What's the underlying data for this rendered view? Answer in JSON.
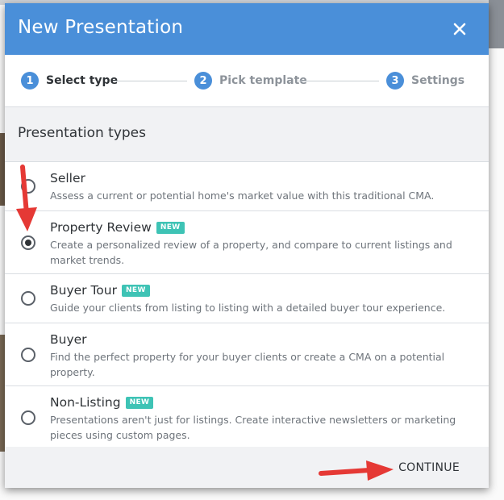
{
  "dialog": {
    "title": "New Presentation",
    "close_icon": "close-icon"
  },
  "stepper": {
    "steps": [
      {
        "number": "1",
        "label": "Select type",
        "active": true
      },
      {
        "number": "2",
        "label": "Pick template",
        "active": false
      },
      {
        "number": "3",
        "label": "Settings",
        "active": false
      }
    ]
  },
  "presentation_types": {
    "heading": "Presentation types",
    "items": [
      {
        "name": "Seller",
        "badge": "",
        "description": "Assess a current or potential home's market value with this traditional CMA.",
        "selected": false
      },
      {
        "name": "Property Review",
        "badge": "NEW",
        "description": "Create a personalized review of a property, and compare to current listings and market trends.",
        "selected": true
      },
      {
        "name": "Buyer Tour",
        "badge": "NEW",
        "description": "Guide your clients from listing to listing with a detailed buyer tour experience.",
        "selected": false
      },
      {
        "name": "Buyer",
        "badge": "",
        "description": "Find the perfect property for your buyer clients or create a CMA on a potential property.",
        "selected": false
      },
      {
        "name": "Non-Listing",
        "badge": "NEW",
        "description": "Presentations aren't just for listings. Create interactive newsletters or marketing pieces using custom pages.",
        "selected": false
      }
    ]
  },
  "footer": {
    "continue_label": "CONTINUE"
  },
  "colors": {
    "header_blue": "#4a8fd9",
    "badge_teal": "#3ec3b5",
    "annotation_red": "#e53935"
  }
}
